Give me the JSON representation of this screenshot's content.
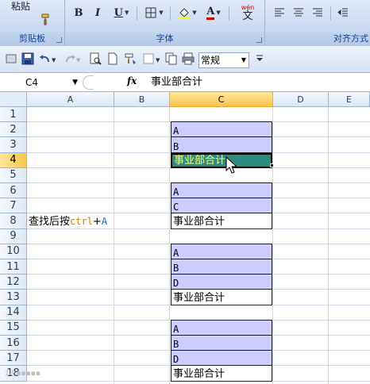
{
  "ribbon": {
    "clipboard_label": "剪贴板",
    "paste_label": "粘贴",
    "font_label": "字体",
    "align_label": "对齐方式",
    "bold": "B",
    "italic": "I",
    "underline": "U",
    "font_color": "A",
    "wen": "wén",
    "wen_char": "文"
  },
  "toolbar": {
    "number_format": "常规"
  },
  "formula_bar": {
    "name_box": "C4",
    "fx": "fx",
    "formula": "事业部合计"
  },
  "columns": [
    "A",
    "B",
    "C",
    "D",
    "E"
  ],
  "selected_column": "C",
  "rows": [
    "1",
    "2",
    "3",
    "4",
    "5",
    "6",
    "7",
    "8",
    "9",
    "10",
    "11",
    "12",
    "13",
    "14",
    "15",
    "16",
    "17",
    "18"
  ],
  "selected_row": "4",
  "note": {
    "prefix": "查找后按",
    "key1": "ctrl",
    "plus": "+",
    "key2": "A"
  },
  "blocks": [
    {
      "cells": [
        "A",
        "B",
        "事业部合计"
      ]
    },
    {
      "cells": [
        "A",
        "C",
        "事业部合计"
      ]
    },
    {
      "cells": [
        "A",
        "B",
        "D",
        "事业部合计"
      ]
    },
    {
      "cells": [
        "A",
        "B",
        "D",
        "事业部合计"
      ]
    }
  ],
  "colors": {
    "lavender": "#ccccff",
    "active_fill": "#2e8b80",
    "active_text": "#ffff66"
  }
}
